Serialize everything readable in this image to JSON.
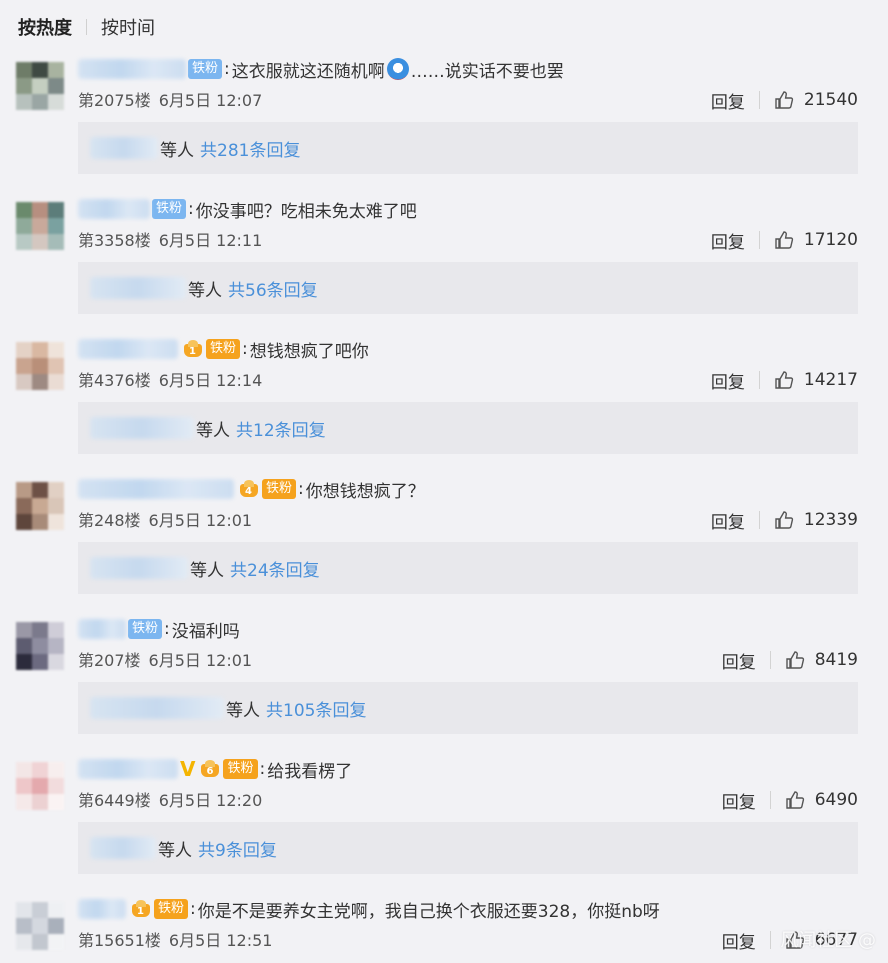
{
  "tabs": {
    "hot": "按热度",
    "time": "按时间"
  },
  "comments": [
    {
      "text": "这衣服就这还随机啊",
      "text_tail": "……说实话不要也罢",
      "badge": "铁粉",
      "floor": "第2075楼",
      "time": "6月5日 12:07",
      "reply_label": "回复",
      "likes": "21540",
      "replies_suffix": "等人",
      "replies_count": "共281条回复"
    },
    {
      "text": "你没事吧？吃相未免太难了吧",
      "badge": "铁粉",
      "floor": "第3358楼",
      "time": "6月5日 12:11",
      "reply_label": "回复",
      "likes": "17120",
      "replies_suffix": "等人",
      "replies_count": "共56条回复"
    },
    {
      "text": "想钱想疯了吧你",
      "badge": "铁粉",
      "crown_level": "1",
      "floor": "第4376楼",
      "time": "6月5日 12:14",
      "reply_label": "回复",
      "likes": "14217",
      "replies_suffix": "等人",
      "replies_count": "共12条回复"
    },
    {
      "text": "你想钱想疯了？",
      "badge": "铁粉",
      "crown_level": "4",
      "floor": "第248楼",
      "time": "6月5日 12:01",
      "reply_label": "回复",
      "likes": "12339",
      "replies_suffix": "等人",
      "replies_count": "共24条回复"
    },
    {
      "text": "没福利吗",
      "badge": "铁粉",
      "floor": "第207楼",
      "time": "6月5日 12:01",
      "reply_label": "回复",
      "likes": "8419",
      "replies_suffix": "等人",
      "replies_count": "共105条回复"
    },
    {
      "text": "给我看楞了",
      "badge": "铁粉",
      "crown_level": "6",
      "floor": "第6449楼",
      "time": "6月5日 12:20",
      "reply_label": "回复",
      "likes": "6490",
      "replies_suffix": "等人",
      "replies_count": "共9条回复"
    },
    {
      "text": "你是不是要养女主党啊，我自己换个衣服还要328，你挺nb呀",
      "badge": "铁粉",
      "crown_level": "1",
      "floor": "第15651楼",
      "time": "6月5日 12:51",
      "reply_label": "回复",
      "likes": "6677"
    }
  ],
  "watermark": "风闻社区 @",
  "colors": {
    "link": "#4a90d9",
    "badge_blue": "#7cb6f0",
    "badge_gold": "#f5a21d"
  }
}
